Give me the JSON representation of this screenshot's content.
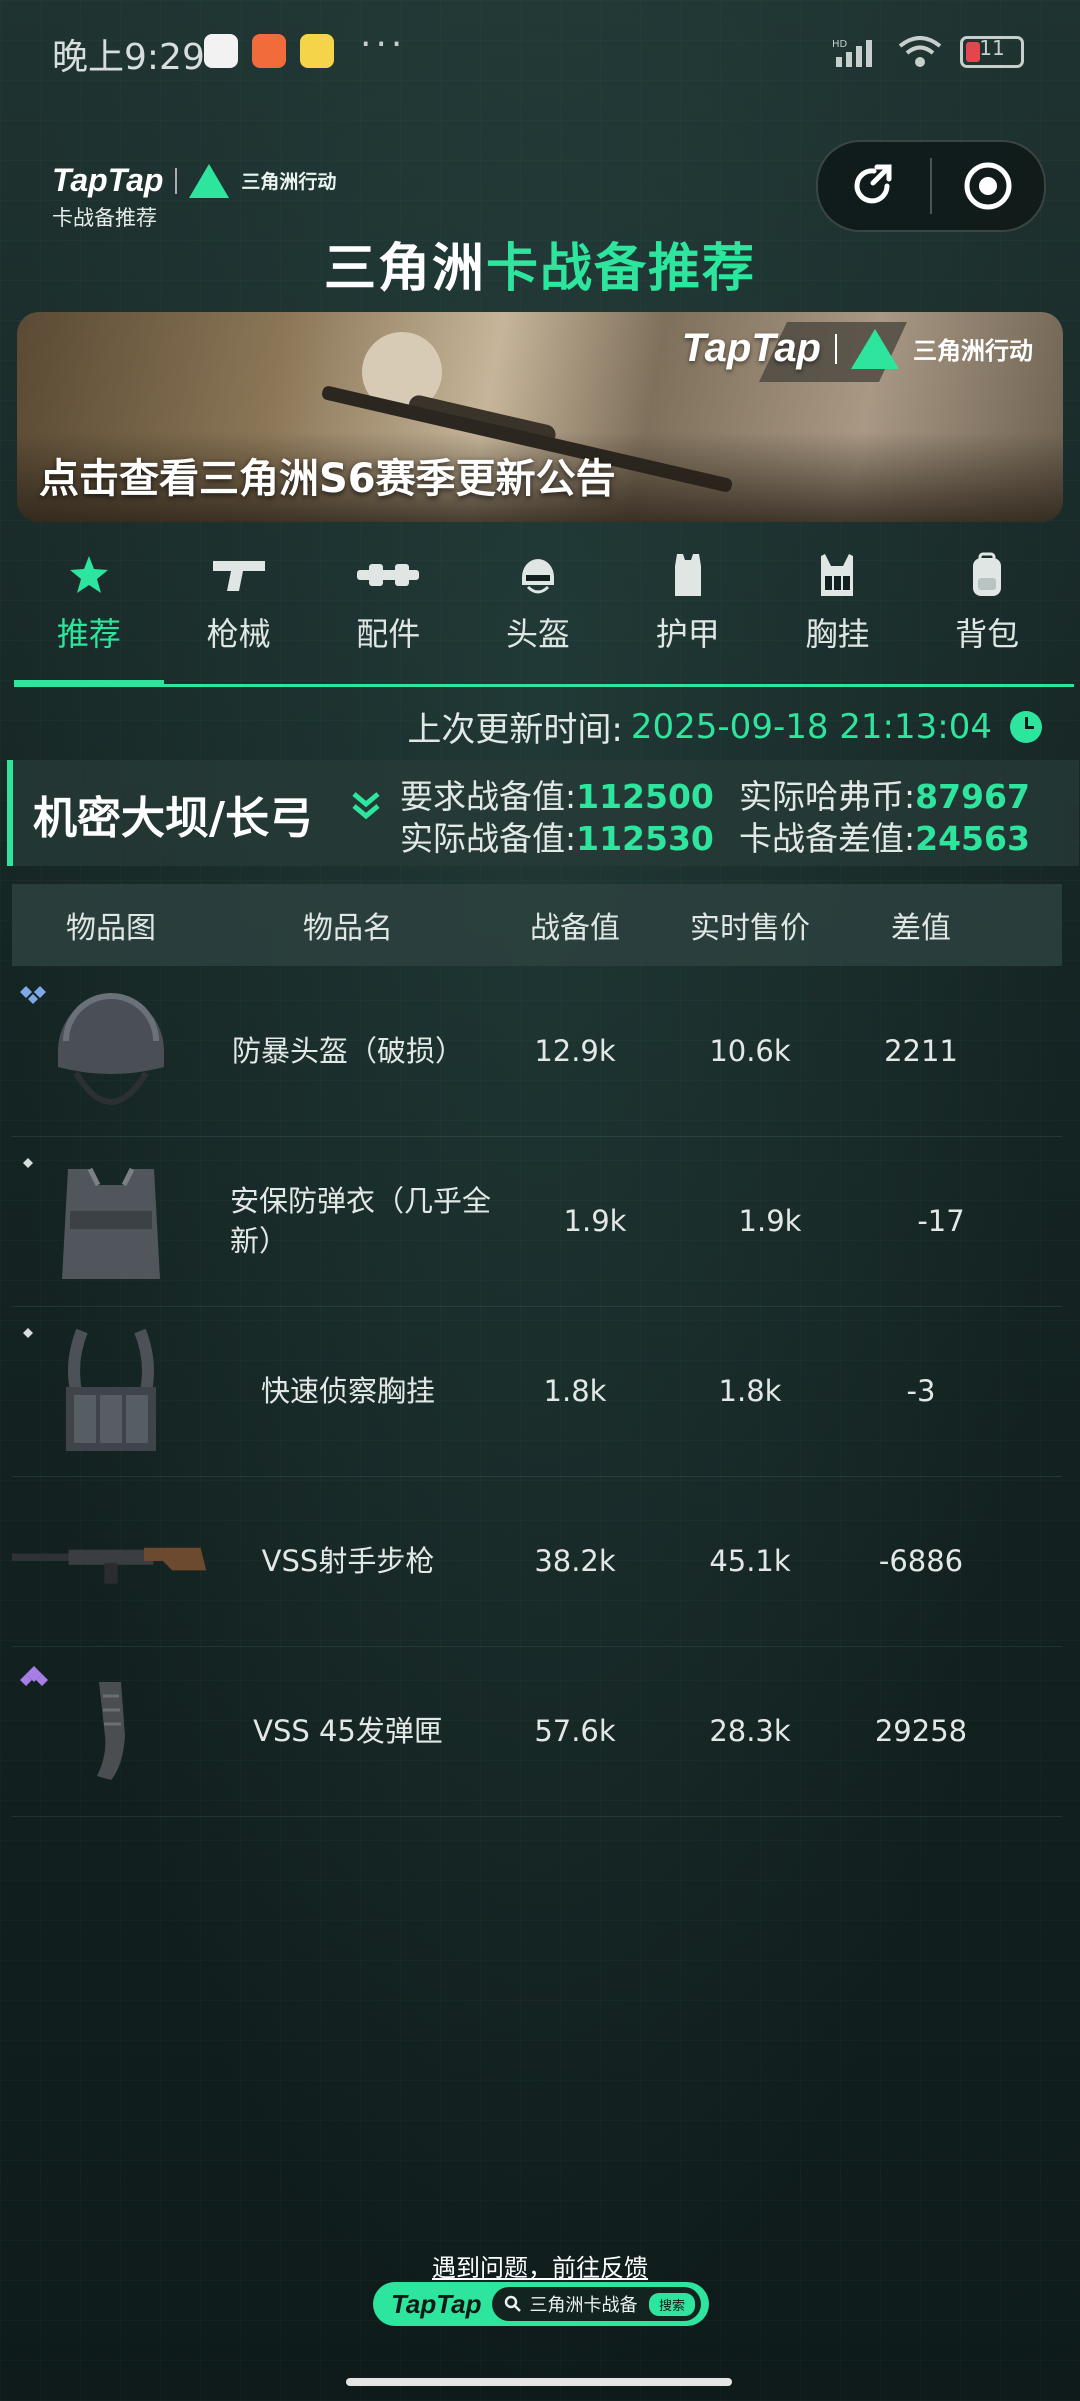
{
  "status_bar": {
    "time": "晚上9:29",
    "dots": "···",
    "battery": "11",
    "network": "HD"
  },
  "header": {
    "brand": "TapTap",
    "game": "三角洲行动",
    "subtitle": "卡战备推荐",
    "title_white": "三角洲",
    "title_green": "卡战备推荐"
  },
  "banner": {
    "brand": "TapTap",
    "game": "三角洲行动",
    "caption": "点击查看三角洲S6赛季更新公告"
  },
  "tabs": [
    {
      "label": "推荐",
      "icon": "star-icon"
    },
    {
      "label": "枪械",
      "icon": "pistol-icon"
    },
    {
      "label": "配件",
      "icon": "scope-icon"
    },
    {
      "label": "头盔",
      "icon": "helmet-icon"
    },
    {
      "label": "护甲",
      "icon": "armor-icon"
    },
    {
      "label": "胸挂",
      "icon": "chest-rig-icon"
    },
    {
      "label": "背包",
      "icon": "backpack-icon"
    }
  ],
  "update": {
    "label": "上次更新时间:",
    "value": "2025-09-18 21:13:04"
  },
  "summary": {
    "map": "机密大坝/长弓",
    "req_label": "要求战备值:",
    "req_value": "112500",
    "act_label": "实际战备值:",
    "act_value": "112530",
    "coin_label": "实际哈弗币:",
    "coin_value": "87967",
    "diff_label": "卡战备差值:",
    "diff_value": "24563"
  },
  "table": {
    "headers": [
      "物品图",
      "物品名",
      "战备值",
      "实时售价",
      "差值"
    ],
    "rows": [
      {
        "name": "防暴头盔（破损）",
        "value": "12.9k",
        "price": "10.6k",
        "diff": "2211",
        "icon": "helmet-item",
        "rarity_color": "#7fa8e6"
      },
      {
        "name": "安保防弹衣（几乎全新）",
        "value": "1.9k",
        "price": "1.9k",
        "diff": "-17",
        "icon": "vest-item",
        "rarity_color": "#d8dede"
      },
      {
        "name": "快速侦察胸挂",
        "value": "1.8k",
        "price": "1.8k",
        "diff": "-3",
        "icon": "chest-rig-item",
        "rarity_color": "#d8dede"
      },
      {
        "name": "VSS射手步枪",
        "value": "38.2k",
        "price": "45.1k",
        "diff": "-6886",
        "icon": "rifle-item",
        "rarity_color": ""
      },
      {
        "name": "VSS 45发弹匣",
        "value": "57.6k",
        "price": "28.3k",
        "diff": "29258",
        "icon": "magazine-item",
        "rarity_color": "#a77ee8"
      }
    ]
  },
  "footer": {
    "feedback": "遇到问题，前往反馈",
    "brand": "TapTap",
    "search_text": "三角洲卡战备",
    "search_button": "搜索"
  },
  "colors": {
    "accent": "#2ee59d",
    "background": "#12201f"
  }
}
